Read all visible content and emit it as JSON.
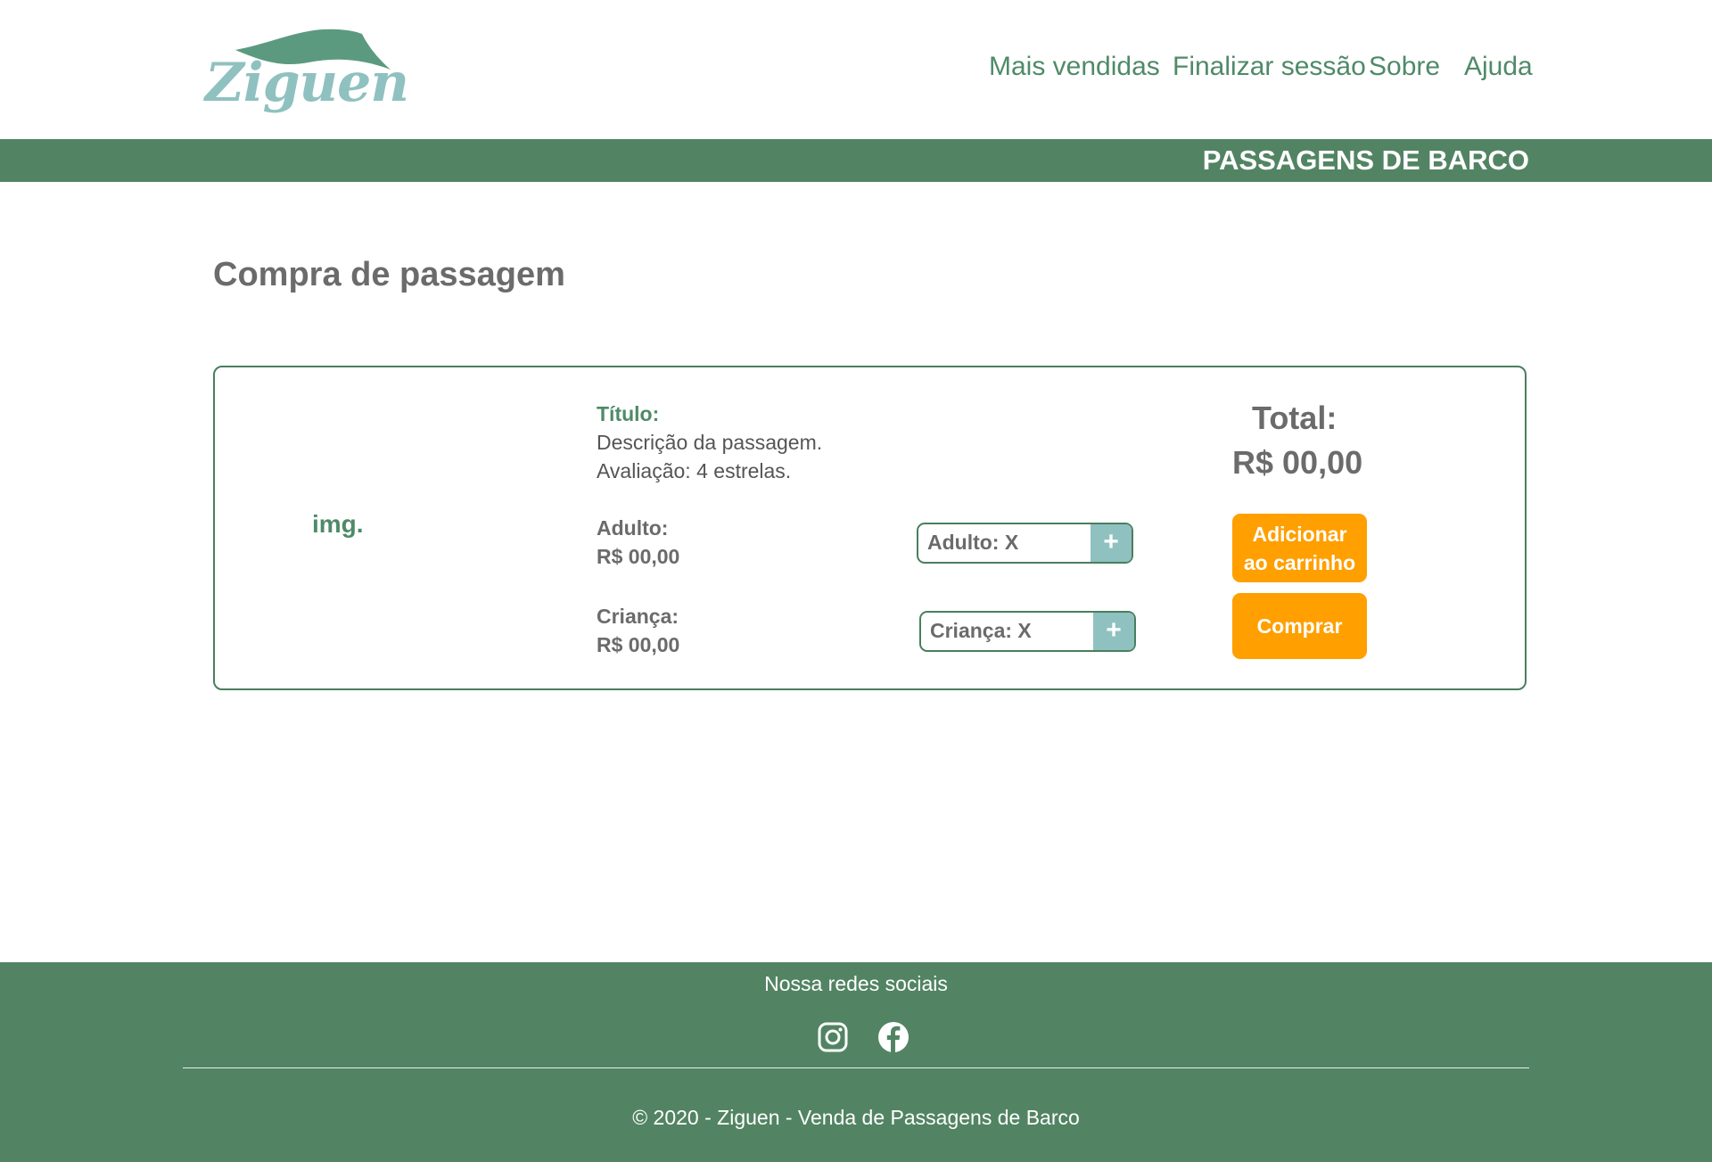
{
  "brand": {
    "name": "Ziguen"
  },
  "nav": {
    "items": [
      {
        "label": "Mais vendidas"
      },
      {
        "label": "Finalizar sessão"
      },
      {
        "label": "Sobre"
      },
      {
        "label": "Ajuda"
      }
    ]
  },
  "banner": {
    "title": "PASSAGENS DE BARCO"
  },
  "page": {
    "title": "Compra de passagem"
  },
  "product": {
    "image_placeholder": "img.",
    "title_label": "Título:",
    "description": "Descrição da passagem.",
    "rating": "Avaliação: 4 estrelas.",
    "adult_label": "Adulto:",
    "adult_price": "R$ 00,00",
    "child_label": "Criança:",
    "child_price": "R$ 00,00",
    "adult_stepper": "Adulto: X",
    "child_stepper": "Criança: X",
    "plus": "+",
    "total_label": "Total:",
    "total_value": "R$ 00,00",
    "add_to_cart": "Adicionar ao carrinho",
    "buy": "Comprar"
  },
  "footer": {
    "social_heading": "Nossa redes sociais",
    "social_icons": [
      "instagram-icon",
      "facebook-icon"
    ],
    "copyright": "© 2020 - Ziguen - Venda de Passagens de Barco"
  },
  "colors": {
    "primary_green": "#528463",
    "accent_teal": "#8fc1c0",
    "button_orange": "#ff9f00",
    "text_gray": "#6b6b6b"
  }
}
